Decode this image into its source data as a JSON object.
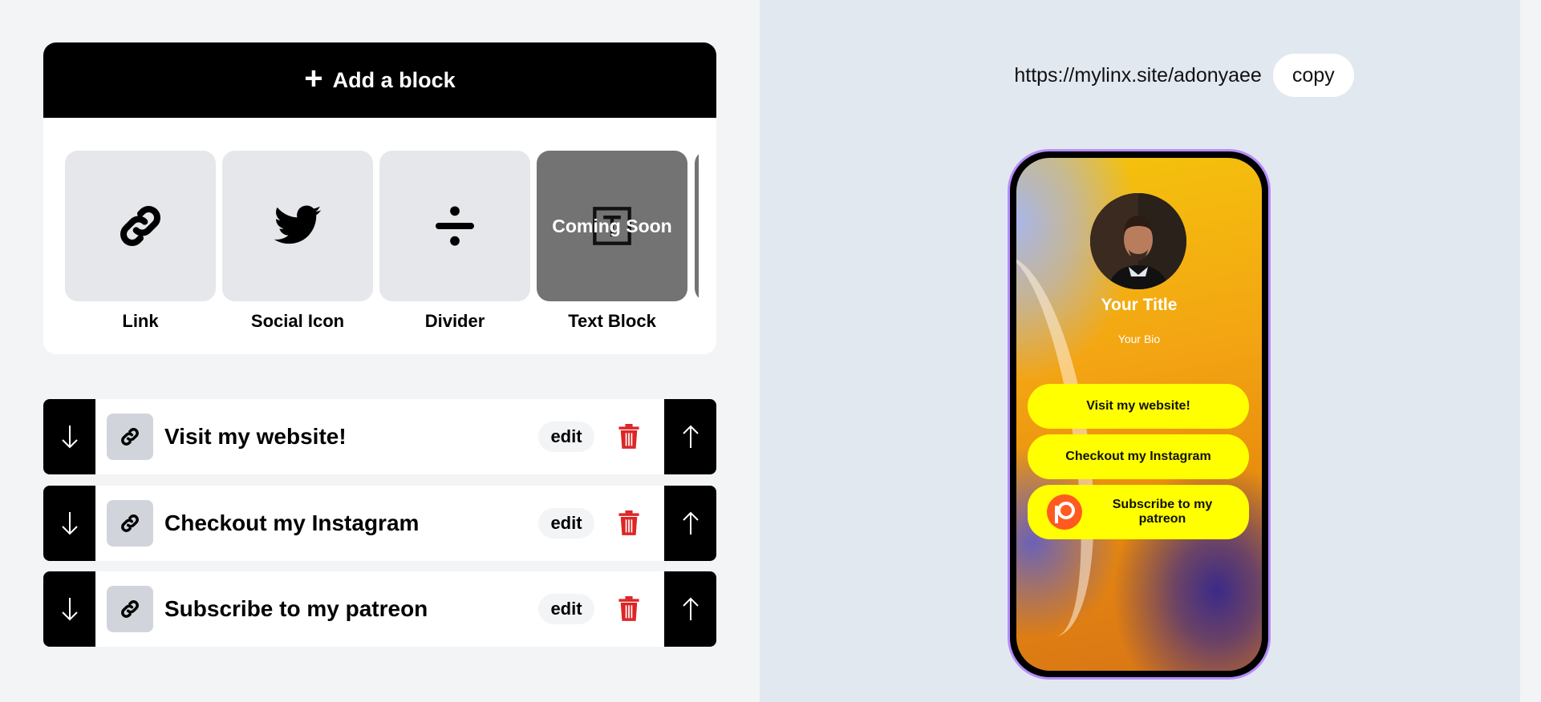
{
  "builder": {
    "add_block_label": "Add a block",
    "blocks": [
      {
        "label": "Link",
        "icon": "link-icon"
      },
      {
        "label": "Social Icon",
        "icon": "twitter-icon"
      },
      {
        "label": "Divider",
        "icon": "divide-icon"
      },
      {
        "label": "Text Block",
        "icon": "text-icon",
        "overlay": "Coming Soon"
      }
    ],
    "items": [
      {
        "title": "Visit my website!",
        "edit_label": "edit"
      },
      {
        "title": "Checkout my Instagram",
        "edit_label": "edit"
      },
      {
        "title": "Subscribe to my patreon",
        "edit_label": "edit"
      }
    ]
  },
  "preview": {
    "url": "https://mylinx.site/adonyaee",
    "copy_label": "copy",
    "profile_title": "Your Title",
    "profile_bio": "Your Bio",
    "buttons": [
      {
        "label": "Visit my website!"
      },
      {
        "label": "Checkout my Instagram"
      },
      {
        "label": "Subscribe to my patreon"
      }
    ],
    "accent_color": "#ffff00",
    "phone_border_color": "#b78cff"
  },
  "colors": {
    "delete_icon": "#dc2626",
    "dark": "#000000"
  }
}
